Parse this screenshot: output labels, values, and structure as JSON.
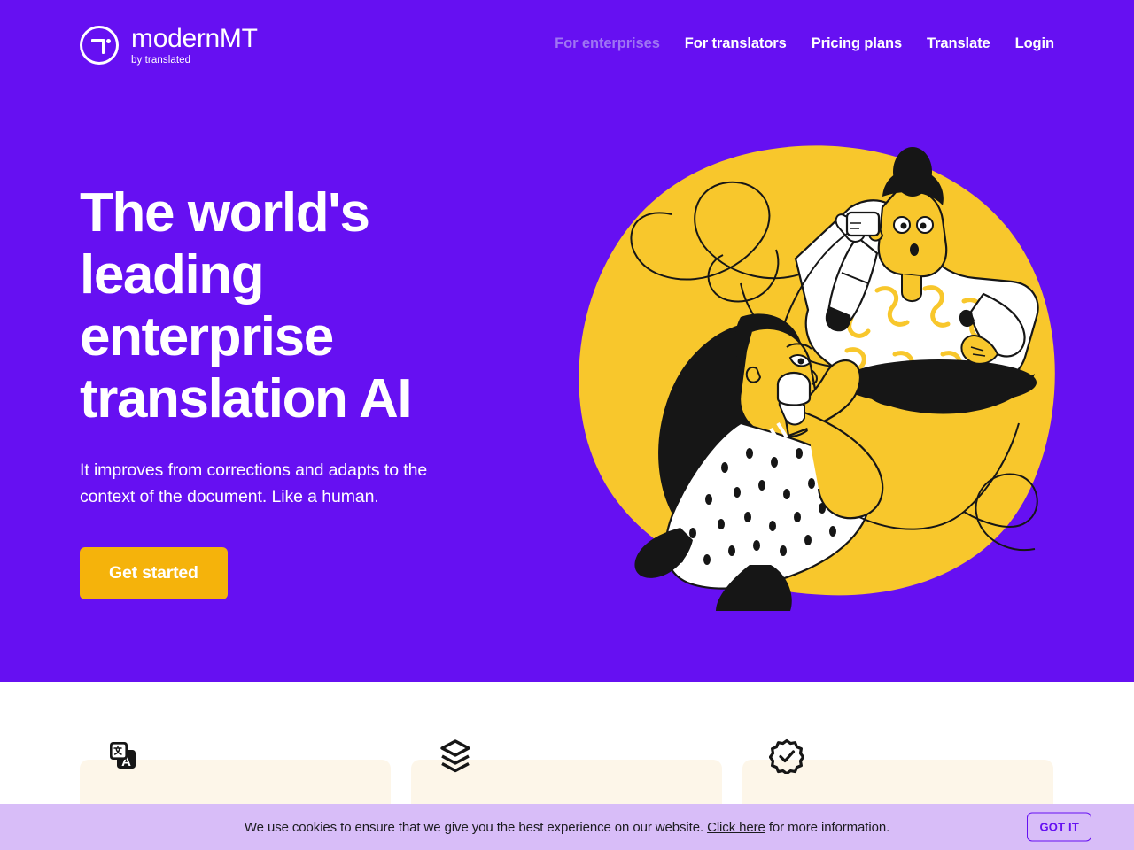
{
  "brand": {
    "name": "modernMT",
    "tagline": "by translated",
    "logo_icon": "modernmt-circle-logo"
  },
  "nav": {
    "items": [
      {
        "label": "For enterprises",
        "state": "muted"
      },
      {
        "label": "For translators",
        "state": "default"
      },
      {
        "label": "Pricing plans",
        "state": "default"
      },
      {
        "label": "Translate",
        "state": "default"
      },
      {
        "label": "Login",
        "state": "default"
      }
    ]
  },
  "hero": {
    "title": "The world's leading enterprise translation AI",
    "subtitle": "It improves from corrections and adapts to the context of the document. Like a human.",
    "cta_label": "Get started",
    "illustration_name": "two-people-tin-can-telephone-illustration"
  },
  "features": {
    "cards": [
      {
        "icon": "translate-icon",
        "label": ""
      },
      {
        "icon": "layers-stack-icon",
        "label": ""
      },
      {
        "icon": "verified-badge-icon",
        "label": ""
      }
    ]
  },
  "cookie_banner": {
    "text_before": "We use cookies to ensure that we give you the best experience on our website. ",
    "link_label": "Click here",
    "text_after": " for more information.",
    "accept_label": "GOT IT"
  },
  "colors": {
    "purple": "#6610f2",
    "yellow": "#f5b30b",
    "cream": "#fdf6e9",
    "lavender": "#d8bdf8",
    "nav_muted": "#9f75f3",
    "white": "#ffffff",
    "ink": "#1b1b1f"
  }
}
